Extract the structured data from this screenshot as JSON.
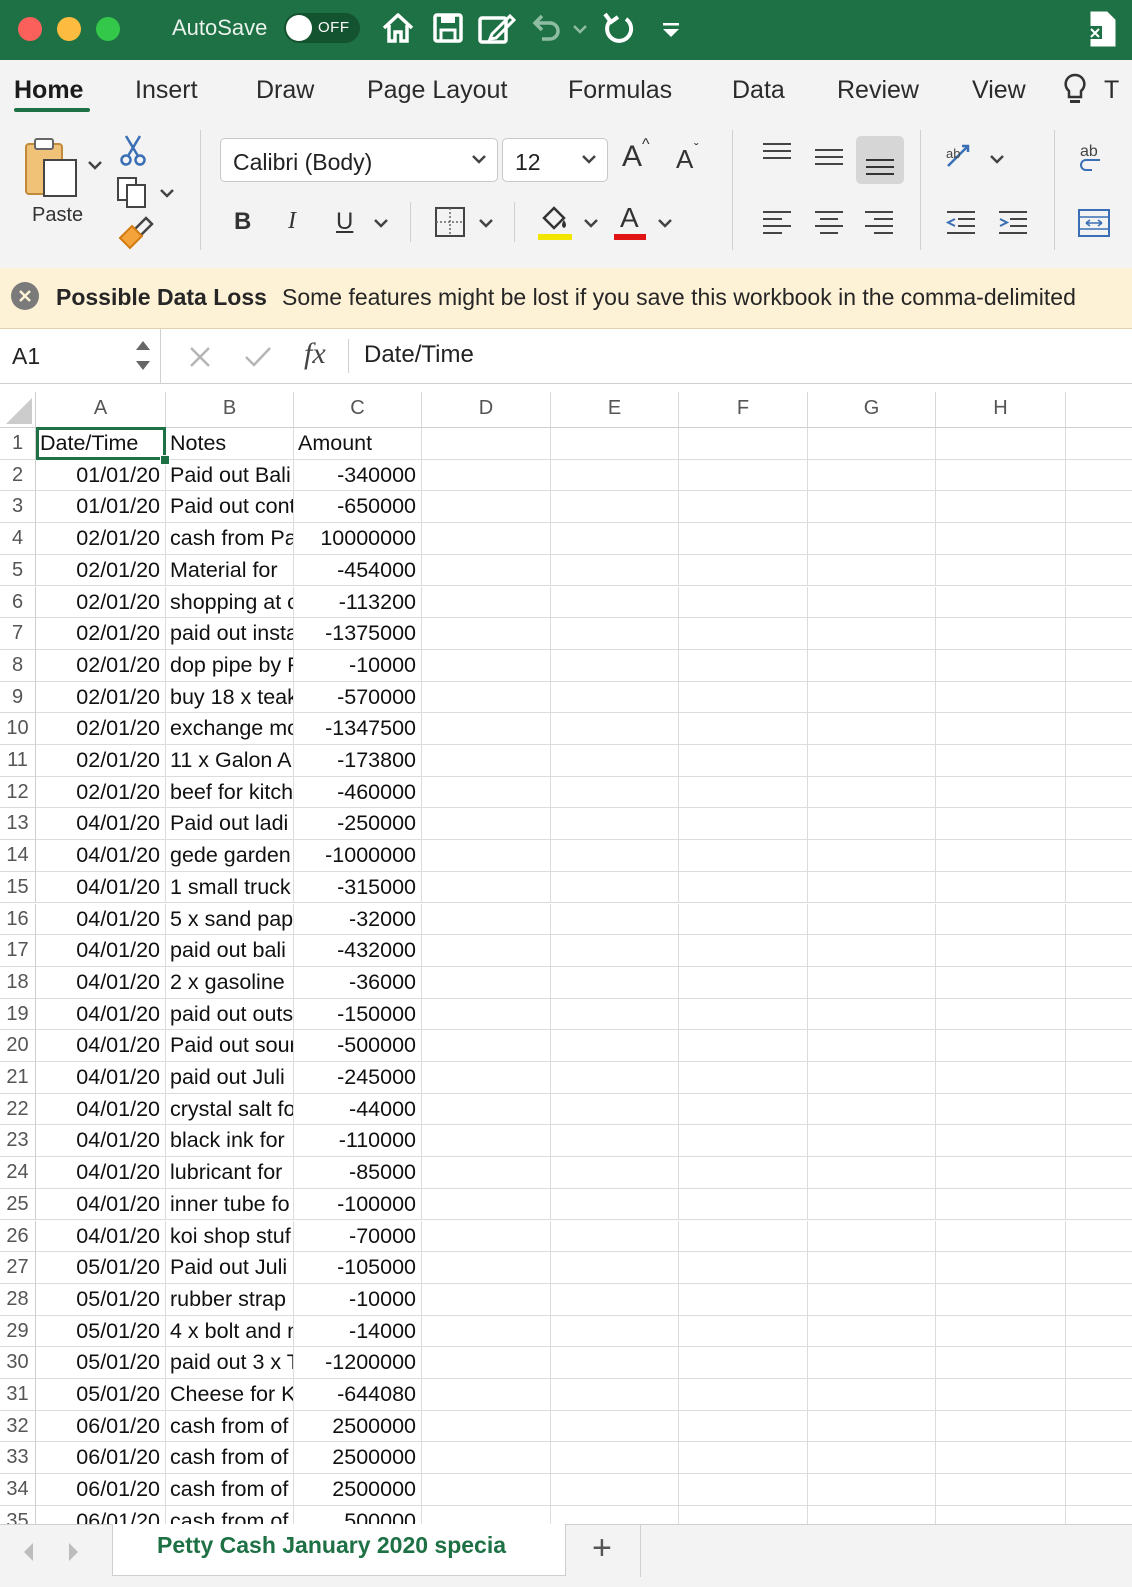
{
  "titlebar": {
    "autosave_label": "AutoSave",
    "autosave_state": "OFF",
    "icons": [
      "home-icon",
      "save-icon",
      "edit-document-icon",
      "undo-icon",
      "redo-icon",
      "customize-toolbar-icon",
      "excel-icon"
    ]
  },
  "tabs": [
    "Home",
    "Insert",
    "Draw",
    "Page Layout",
    "Formulas",
    "Data",
    "Review",
    "View",
    "T"
  ],
  "ribbon": {
    "paste_label": "Paste",
    "font_name": "Calibri (Body)",
    "font_size": "12",
    "increase_font": "A",
    "decrease_font": "A",
    "bold": "B",
    "italic": "I",
    "underline": "U",
    "font_color_letter": "A",
    "wrap_icon_text": "ab"
  },
  "message_bar": {
    "title": "Possible Data Loss",
    "text": "Some features might be lost if you save this workbook in the comma-delimited"
  },
  "formula_bar": {
    "cell_ref": "A1",
    "fx": "fx",
    "value": "Date/Time"
  },
  "sheet": {
    "columns": [
      "A",
      "B",
      "C",
      "D",
      "E",
      "F",
      "G",
      "H"
    ],
    "header_row": [
      "Date/Time",
      "Notes",
      "Amount"
    ],
    "rows": [
      [
        "01/01/20",
        "Paid out Bali",
        "-340000"
      ],
      [
        "01/01/20",
        "Paid out cont",
        "-650000"
      ],
      [
        "02/01/20",
        "cash from Pa",
        "10000000"
      ],
      [
        "02/01/20",
        "Material for",
        "-454000"
      ],
      [
        "02/01/20",
        "shopping at c",
        "-113200"
      ],
      [
        "02/01/20",
        "paid out insta",
        "-1375000"
      ],
      [
        "02/01/20",
        "dop pipe by P",
        "-10000"
      ],
      [
        "02/01/20",
        "buy 18 x teak",
        "-570000"
      ],
      [
        "02/01/20",
        "exchange mo",
        "-1347500"
      ],
      [
        "02/01/20",
        "11 x Galon A",
        "-173800"
      ],
      [
        "02/01/20",
        "beef for kitch",
        "-460000"
      ],
      [
        "04/01/20",
        "Paid out ladi",
        "-250000"
      ],
      [
        "04/01/20",
        "gede garden",
        "-1000000"
      ],
      [
        "04/01/20",
        "1 small truck",
        "-315000"
      ],
      [
        "04/01/20",
        "5 x sand pap",
        "-32000"
      ],
      [
        "04/01/20",
        "paid out bali",
        "-432000"
      ],
      [
        "04/01/20",
        "2 x gasoline",
        "-36000"
      ],
      [
        "04/01/20",
        "paid out outs",
        "-150000"
      ],
      [
        "04/01/20",
        "Paid out sour",
        "-500000"
      ],
      [
        "04/01/20",
        "paid out Juli",
        "-245000"
      ],
      [
        "04/01/20",
        "crystal salt fo",
        "-44000"
      ],
      [
        "04/01/20",
        "black ink for",
        "-110000"
      ],
      [
        "04/01/20",
        "lubricant for",
        "-85000"
      ],
      [
        "04/01/20",
        "inner tube fo",
        "-100000"
      ],
      [
        "04/01/20",
        "koi shop stuf",
        "-70000"
      ],
      [
        "05/01/20",
        "Paid out Juli",
        "-105000"
      ],
      [
        "05/01/20",
        "rubber strap",
        "-10000"
      ],
      [
        "05/01/20",
        "4 x bolt and n",
        "-14000"
      ],
      [
        "05/01/20",
        "paid out 3 x T",
        "-1200000"
      ],
      [
        "05/01/20",
        "Cheese for K",
        "-644080"
      ],
      [
        "06/01/20",
        "cash from of",
        "2500000"
      ],
      [
        "06/01/20",
        "cash from of",
        "2500000"
      ],
      [
        "06/01/20",
        "cash from of",
        "2500000"
      ],
      [
        "06/01/20",
        "cash from of",
        "500000"
      ]
    ]
  },
  "sheet_tabs": {
    "active": "Petty Cash  January 2020 specia",
    "add": "+"
  },
  "colors": {
    "excel_green": "#1e7145",
    "ribbon_bg": "#f3f3f3",
    "message_bg": "#fdf1d6",
    "highlight_yellow": "#f2e600",
    "font_red": "#e01414"
  }
}
